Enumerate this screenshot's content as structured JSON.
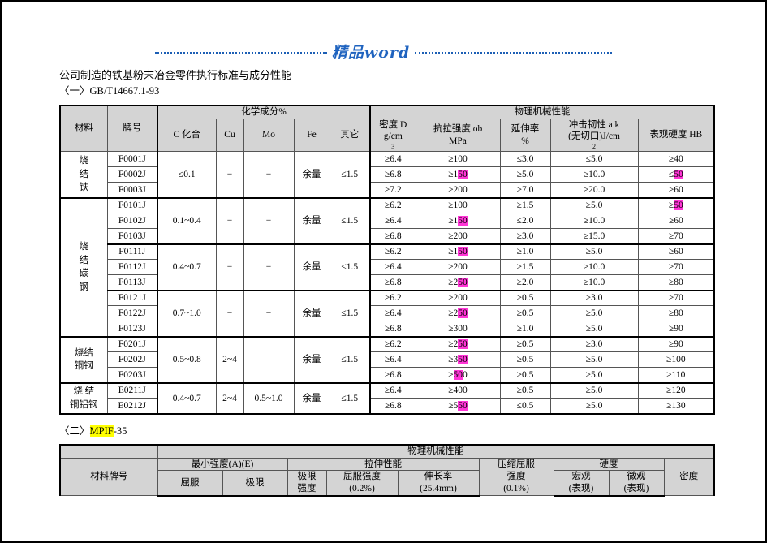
{
  "header": {
    "decoration_text": "精品word",
    "decoration_color": "#1f63bf"
  },
  "doc": {
    "title_line": "公司制造的铁基粉末冶金零件执行标准与成分性能",
    "section_one": "〈一〉GB/T14667.1-93",
    "section_two_prefix": "〈二〉",
    "section_two_highlight": "MPIF",
    "section_two_suffix": "-35",
    "highlight_yellow": "#ffff00",
    "highlight_magenta": "#ff35d6"
  },
  "table1": {
    "group_headers": {
      "material": "材料",
      "grade": "牌号",
      "chemical": "化学成分%",
      "mechanical": "物理机械性能"
    },
    "columns": {
      "c_combined": "C 化合",
      "cu": "Cu",
      "mo": "Mo",
      "fe": "Fe",
      "other": "其它",
      "density_l1": "密度 D",
      "density_l2": "g/cm",
      "density_sup": "3",
      "tensile_l1": "抗拉强度 ob",
      "tensile_l2": "MPa",
      "elong_l1": "延伸率",
      "elong_l2": "%",
      "impact_l1": "冲击韧性 a k",
      "impact_l2": "(无切口)J/cm",
      "impact_sup": "2",
      "hardness": "表观硬度 HB"
    },
    "groups": [
      {
        "material": "烧\n结\n铁",
        "material_mode": "vertical",
        "grades": [
          "F0001J",
          "F0002J",
          "F0003J"
        ],
        "c_combined": "≤0.1",
        "cu": "−",
        "mo": "−",
        "fe": "余量",
        "other": "≤1.5",
        "density": [
          "≥6.4",
          "≥6.8",
          "≥7.2"
        ],
        "tensile": [
          {
            "pre": "≥100",
            "hl": "",
            "post": ""
          },
          {
            "pre": "≥1",
            "hl": "50",
            "post": ""
          },
          {
            "pre": "≥200",
            "hl": "",
            "post": ""
          }
        ],
        "elong": [
          "≤3.0",
          "≥5.0",
          "≥7.0"
        ],
        "impact": [
          "≤5.0",
          "≥10.0",
          "≥20.0"
        ],
        "hardness": [
          {
            "pre": "≥40",
            "hl": "",
            "post": ""
          },
          {
            "pre": "≤",
            "hl": "50",
            "post": ""
          },
          {
            "pre": "≥60",
            "hl": "",
            "post": ""
          }
        ]
      },
      {
        "material": "",
        "material_mode": "none",
        "grades": [
          "F0101J",
          "F0102J",
          "F0103J"
        ],
        "c_combined": "0.1~0.4",
        "cu": "−",
        "mo": "−",
        "fe": "余量",
        "other": "≤1.5",
        "density": [
          "≥6.2",
          "≥6.4",
          "≥6.8"
        ],
        "tensile": [
          {
            "pre": "≥100",
            "hl": "",
            "post": ""
          },
          {
            "pre": "≥1",
            "hl": "50",
            "post": ""
          },
          {
            "pre": "≥200",
            "hl": "",
            "post": ""
          }
        ],
        "elong": [
          "≥1.5",
          "≤2.0",
          "≥3.0"
        ],
        "impact": [
          "≥5.0",
          "≥10.0",
          "≥15.0"
        ],
        "hardness": [
          {
            "pre": "≥",
            "hl": "50",
            "post": ""
          },
          {
            "pre": "≥60",
            "hl": "",
            "post": ""
          },
          {
            "pre": "≥70",
            "hl": "",
            "post": ""
          }
        ]
      },
      {
        "material": "烧\n结\n碳\n钢",
        "material_mode": "spanning",
        "grades": [
          "F0111J",
          "F0112J",
          "F0113J"
        ],
        "c_combined": "0.4~0.7",
        "cu": "−",
        "mo": "−",
        "fe": "余量",
        "other": "≤1.5",
        "density": [
          "≥6.2",
          "≥6.4",
          "≥6.8"
        ],
        "tensile": [
          {
            "pre": "≥1",
            "hl": "50",
            "post": ""
          },
          {
            "pre": "≥200",
            "hl": "",
            "post": ""
          },
          {
            "pre": "≥2",
            "hl": "50",
            "post": ""
          }
        ],
        "elong": [
          "≥1.0",
          "≥1.5",
          "≥2.0"
        ],
        "impact": [
          "≥5.0",
          "≥10.0",
          "≥10.0"
        ],
        "hardness": [
          {
            "pre": "≥60",
            "hl": "",
            "post": ""
          },
          {
            "pre": "≥70",
            "hl": "",
            "post": ""
          },
          {
            "pre": "≥80",
            "hl": "",
            "post": ""
          }
        ]
      },
      {
        "material": "",
        "material_mode": "none",
        "grades": [
          "F0121J",
          "F0122J",
          "F0123J"
        ],
        "c_combined": "0.7~1.0",
        "cu": "−",
        "mo": "−",
        "fe": "余量",
        "other": "≤1.5",
        "density": [
          "≥6.2",
          "≥6.4",
          "≥6.8"
        ],
        "tensile": [
          {
            "pre": "≥200",
            "hl": "",
            "post": ""
          },
          {
            "pre": "≥2",
            "hl": "50",
            "post": ""
          },
          {
            "pre": "≥300",
            "hl": "",
            "post": ""
          }
        ],
        "elong": [
          "≥0.5",
          "≥0.5",
          "≥1.0"
        ],
        "impact": [
          "≥3.0",
          "≥5.0",
          "≥5.0"
        ],
        "hardness": [
          {
            "pre": "≥70",
            "hl": "",
            "post": ""
          },
          {
            "pre": "≥80",
            "hl": "",
            "post": ""
          },
          {
            "pre": "≥90",
            "hl": "",
            "post": ""
          }
        ]
      },
      {
        "material": "烧结\n铜钢",
        "material_mode": "block",
        "grades": [
          "F0201J",
          "F0202J",
          "F0203J"
        ],
        "c_combined": "0.5~0.8",
        "cu": "2~4",
        "mo": "",
        "fe": "余量",
        "other": "≤1.5",
        "density": [
          "≥6.2",
          "≥6.4",
          "≥6.8"
        ],
        "tensile": [
          {
            "pre": "≥2",
            "hl": "50",
            "post": ""
          },
          {
            "pre": "≥3",
            "hl": "50",
            "post": ""
          },
          {
            "pre": "≥",
            "hl": "50",
            "post": "0"
          }
        ],
        "elong": [
          "≥0.5",
          "≥0.5",
          "≥0.5"
        ],
        "impact": [
          "≥3.0",
          "≥5.0",
          "≥5.0"
        ],
        "hardness": [
          {
            "pre": "≥90",
            "hl": "",
            "post": ""
          },
          {
            "pre": "≥100",
            "hl": "",
            "post": ""
          },
          {
            "pre": "≥110",
            "hl": "",
            "post": ""
          }
        ]
      },
      {
        "material": "烧 结\n铜铝钢",
        "material_mode": "block",
        "grades": [
          "E0211J",
          "E0212J"
        ],
        "c_combined": "0.4~0.7",
        "cu": "2~4",
        "mo": "0.5~1.0",
        "fe": "余量",
        "other": "≤1.5",
        "density": [
          "≥6.4",
          "≥6.8"
        ],
        "tensile": [
          {
            "pre": "≥400",
            "hl": "",
            "post": ""
          },
          {
            "pre": "≥5",
            "hl": "50",
            "post": ""
          }
        ],
        "elong": [
          "≥0.5",
          "≤0.5"
        ],
        "impact": [
          "≥5.0",
          "≥5.0"
        ],
        "hardness": [
          {
            "pre": "≥120",
            "hl": "",
            "post": ""
          },
          {
            "pre": "≥130",
            "hl": "",
            "post": ""
          }
        ]
      }
    ]
  },
  "table2": {
    "top_header": "物理机械性能",
    "material_grade": "材料牌号",
    "min_strength": "最小强度(A)(E)",
    "yield": "屈服",
    "ultimate": "极限",
    "tensile_props": "拉伸性能",
    "ultimate_strength_l1": "极限",
    "ultimate_strength_l2": "强度",
    "yield_strength_l1": "屈服强度",
    "yield_strength_l2": "(0.2%)",
    "elongation_l1": "伸长率",
    "elongation_l2": "(25.4mm)",
    "compress_yield_l1": "压缩屈服",
    "compress_yield_l2": "强度",
    "compress_yield_l3": "(0.1%)",
    "hardness": "硬度",
    "macro_l1": "宏观",
    "macro_l2": "(表现)",
    "micro_l1": "微观",
    "micro_l2": "(表现)",
    "density": "密度"
  }
}
